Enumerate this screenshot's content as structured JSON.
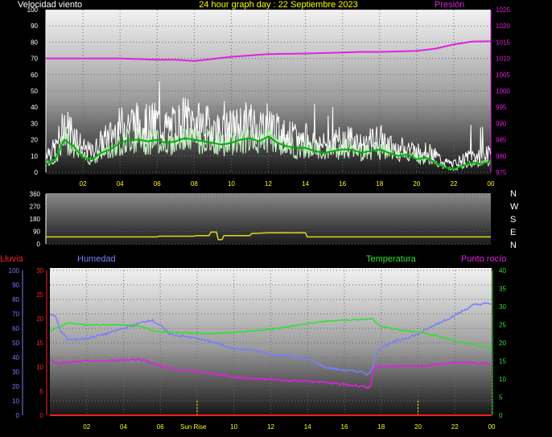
{
  "header": {
    "title": "24 hour graph day : 22 Septiembre 2023",
    "wind_label": "Velocidad viento",
    "pressure_label": "Presión"
  },
  "direction_legend": [
    "N",
    "W",
    "S",
    "E",
    "N"
  ],
  "bottom_labels": {
    "rain": "Lluvia",
    "humidity": "Humedad",
    "temperature": "Temperatura",
    "dewpoint": "Punto rocío",
    "sun_marker": "Sun Rise"
  },
  "colors": {
    "wind_gust": "#ffffff",
    "wind_avg_light": "#c8f5c8",
    "wind_avg": "#00b000",
    "pressure": "#e020e0",
    "direction": "#d8d820",
    "humidity": "#7b7bff",
    "temperature": "#30e030",
    "dewpoint": "#e020e0",
    "rain": "#ff2020",
    "time_axis": "#ffff00",
    "marker": "#ffff00"
  },
  "chart_data": [
    {
      "type": "line",
      "title": "24 hour graph day : 22 Septiembre 2023",
      "x_ticks": [
        "02",
        "04",
        "06",
        "08",
        "10",
        "12",
        "14",
        "16",
        "18",
        "20",
        "22",
        "00"
      ],
      "x_range_hours": [
        0,
        24
      ],
      "y_left": {
        "label": "Velocidad viento",
        "range": [
          0,
          100
        ],
        "ticks": [
          0,
          10,
          20,
          30,
          40,
          50,
          60,
          70,
          80,
          90,
          100
        ]
      },
      "y_right": {
        "label": "Presión",
        "range": [
          975,
          1025
        ],
        "ticks": [
          975,
          980,
          985,
          990,
          995,
          1000,
          1005,
          1010,
          1015,
          1020,
          1025
        ]
      },
      "series": [
        {
          "name": "Presión",
          "axis": "right",
          "x": [
            0,
            2,
            4,
            6,
            7,
            8,
            10,
            12,
            14,
            16,
            17,
            18,
            20,
            21,
            22,
            23,
            24
          ],
          "y": [
            1010,
            1010,
            1010,
            1009.6,
            1009.6,
            1009.2,
            1010.5,
            1011.3,
            1011.5,
            1011.8,
            1012,
            1012,
            1012.3,
            1013,
            1014.3,
            1015.2,
            1015.3
          ]
        },
        {
          "name": "Velocidad viento",
          "axis": "left",
          "x": [
            0,
            0.5,
            1,
            1.5,
            2,
            2.5,
            3,
            3.5,
            4,
            4.5,
            5,
            5.5,
            6,
            6.5,
            7,
            7.5,
            8,
            8.5,
            9,
            9.5,
            10,
            10.5,
            11,
            11.5,
            12,
            12.5,
            13,
            13.5,
            14,
            14.5,
            15,
            15.5,
            16,
            16.5,
            17,
            17.5,
            18,
            18.5,
            19,
            19.5,
            20,
            20.5,
            21,
            21.5,
            22,
            22.5,
            23,
            23.5,
            24
          ],
          "y": [
            12,
            14,
            28,
            24,
            14,
            12,
            18,
            22,
            27,
            30,
            29,
            28,
            30,
            26,
            28,
            32,
            30,
            28,
            27,
            24,
            26,
            28,
            30,
            27,
            30,
            24,
            22,
            20,
            20,
            18,
            16,
            18,
            19,
            20,
            16,
            18,
            20,
            16,
            14,
            15,
            12,
            13,
            10,
            6,
            5,
            8,
            10,
            9,
            12
          ]
        },
        {
          "name": "Velocidad viento (media)",
          "axis": "left",
          "x": [
            0,
            0.5,
            1,
            1.5,
            2,
            2.5,
            3,
            3.5,
            4,
            4.5,
            5,
            5.5,
            6,
            6.5,
            7,
            7.5,
            8,
            8.5,
            9,
            9.5,
            10,
            10.5,
            11,
            11.5,
            12,
            12.5,
            13,
            13.5,
            14,
            14.5,
            15,
            15.5,
            16,
            16.5,
            17,
            17.5,
            18,
            18.5,
            19,
            19.5,
            20,
            20.5,
            21,
            21.5,
            22,
            22.5,
            23,
            23.5,
            24
          ],
          "y": [
            5,
            8,
            20,
            16,
            9,
            8,
            12,
            14,
            18,
            20,
            20,
            19,
            20,
            18,
            19,
            21,
            20,
            19,
            18,
            17,
            18,
            20,
            21,
            19,
            22,
            18,
            16,
            15,
            15,
            13,
            12,
            13,
            14,
            14,
            12,
            13,
            14,
            12,
            10,
            11,
            8,
            9,
            6,
            3,
            2,
            4,
            6,
            5,
            7
          ]
        }
      ]
    },
    {
      "type": "line",
      "title": "",
      "x_range_hours": [
        0,
        24
      ],
      "y_left": {
        "label": "",
        "range": [
          0,
          360
        ],
        "ticks": [
          0,
          90,
          180,
          270,
          360
        ]
      },
      "series": [
        {
          "name": "Dirección viento",
          "x": [
            0,
            6,
            6.1,
            8,
            8.1,
            8.8,
            8.9,
            9.2,
            9.3,
            9.5,
            9.6,
            11.0,
            11.1,
            12,
            14,
            14.1,
            24
          ],
          "y": [
            50,
            50,
            55,
            55,
            60,
            60,
            85,
            85,
            30,
            30,
            60,
            60,
            75,
            80,
            80,
            50,
            50
          ]
        }
      ]
    },
    {
      "type": "line",
      "title": "",
      "x_ticks": [
        "02",
        "04",
        "06",
        "08",
        "10",
        "12",
        "14",
        "16",
        "18",
        "20",
        "22",
        "00"
      ],
      "x_range_hours": [
        0,
        24
      ],
      "y_rain": {
        "label": "Lluvia",
        "range": [
          0,
          30
        ],
        "ticks": [
          0,
          5,
          10,
          15,
          20,
          25,
          30
        ]
      },
      "y_humidity": {
        "label": "Humedad",
        "range": [
          0,
          100
        ],
        "ticks": [
          0,
          10,
          20,
          30,
          40,
          50,
          60,
          70,
          80,
          90,
          100
        ]
      },
      "y_temperature": {
        "label": "Temperatura",
        "range": [
          0,
          40
        ],
        "ticks": [
          0,
          5,
          10,
          15,
          20,
          25,
          30,
          35,
          40
        ]
      },
      "series": [
        {
          "name": "Humedad",
          "axis": "humidity",
          "x": [
            0,
            0.3,
            0.6,
            1,
            2,
            3,
            4,
            5,
            5.5,
            6,
            6.5,
            8,
            9,
            10,
            11,
            12,
            13,
            14,
            15,
            16,
            17,
            17.3,
            17.5,
            17.8,
            18,
            19,
            20,
            21,
            22,
            23,
            23.5,
            24
          ],
          "y": [
            70,
            68,
            58,
            52,
            53,
            56,
            60,
            64,
            66,
            62,
            56,
            53,
            50,
            46,
            45,
            42,
            41,
            39,
            33,
            31,
            30,
            28,
            32,
            45,
            47,
            52,
            56,
            63,
            69,
            76,
            77,
            77
          ]
        },
        {
          "name": "Temperatura",
          "axis": "temperature",
          "x": [
            0,
            0.3,
            1,
            2,
            3,
            4,
            5,
            5.5,
            6,
            7,
            8,
            9,
            10,
            11,
            12,
            13,
            14,
            15,
            16,
            17,
            17.5,
            18,
            19,
            20,
            21,
            22,
            23,
            24
          ],
          "y": [
            23,
            24,
            25.5,
            25,
            25,
            25,
            24.5,
            23.5,
            23,
            22.8,
            22.6,
            22.6,
            22.8,
            23.2,
            23.8,
            24.5,
            25.3,
            26,
            26.3,
            26.5,
            26.6,
            24.5,
            23.6,
            23,
            22,
            20.5,
            19.5,
            18.5
          ]
        },
        {
          "name": "Punto rocío",
          "axis": "temperature",
          "x": [
            0,
            0.3,
            1,
            2,
            3,
            4,
            5,
            5.5,
            6,
            7,
            8,
            9,
            10,
            11,
            12,
            13,
            14,
            15,
            16,
            17,
            17.4,
            17.6,
            18,
            19,
            20,
            21,
            22,
            23,
            24
          ],
          "y": [
            15.5,
            14.5,
            14.5,
            15,
            15,
            15.3,
            15.5,
            14.5,
            13.5,
            12.5,
            12,
            11.5,
            10.5,
            10.2,
            10,
            9.5,
            9.5,
            9,
            8.5,
            8,
            7.5,
            13,
            13.5,
            13.5,
            13.5,
            14,
            14.5,
            14.5,
            14.2
          ]
        },
        {
          "name": "Lluvia",
          "axis": "rain",
          "x": [
            0,
            24
          ],
          "y": [
            0,
            0
          ]
        }
      ],
      "markers": [
        {
          "label": "Sun Rise",
          "hour": 8
        },
        {
          "label": "",
          "hour": 20
        }
      ]
    }
  ]
}
